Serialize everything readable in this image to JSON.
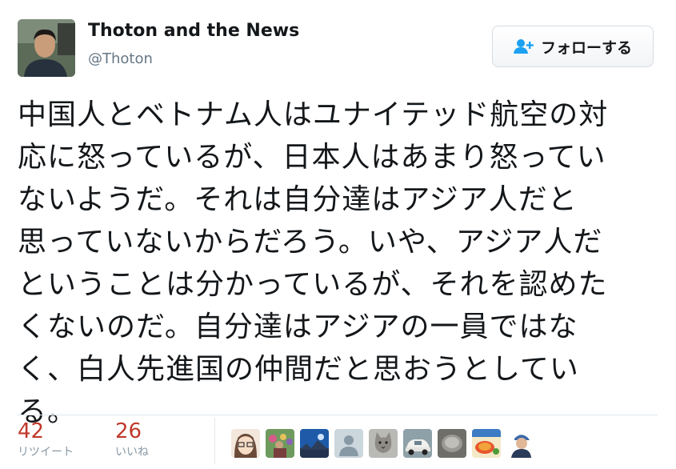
{
  "header": {
    "display_name": "Thoton and the News",
    "handle": "@Thoton"
  },
  "follow_button": {
    "label": "フォローする",
    "icon": "follow-user-icon"
  },
  "tweet": {
    "text": "中国人とベトナム人はユナイテッド航空の対\n応に怒っているが、日本人はあまり怒ってい\nないようだ。それは自分達はアジア人だと\n思っていないからだろう。いや、アジア人だ\nということは分かっているが、それを認めた\nくないのだ。自分達はアジアの一員ではな\nく、白人先進国の仲間だと思おうとしてい\nる。"
  },
  "stats": {
    "retweets": {
      "count": "42",
      "label": "リツイート"
    },
    "likes": {
      "count": "26",
      "label": "いいね"
    }
  },
  "liked_by": [
    {
      "icon": "anime-avatar-icon"
    },
    {
      "icon": "crowd-avatar-icon"
    },
    {
      "icon": "sky-avatar-icon"
    },
    {
      "icon": "default-avatar-icon"
    },
    {
      "icon": "cat-avatar-icon"
    },
    {
      "icon": "car-avatar-icon"
    },
    {
      "icon": "bowl-avatar-icon"
    },
    {
      "icon": "food-avatar-icon"
    },
    {
      "icon": "person-cap-avatar-icon"
    }
  ],
  "colors": {
    "stat_number": "#c0392b",
    "follow_icon": "#1da1f2",
    "secondary_text": "#657786"
  }
}
